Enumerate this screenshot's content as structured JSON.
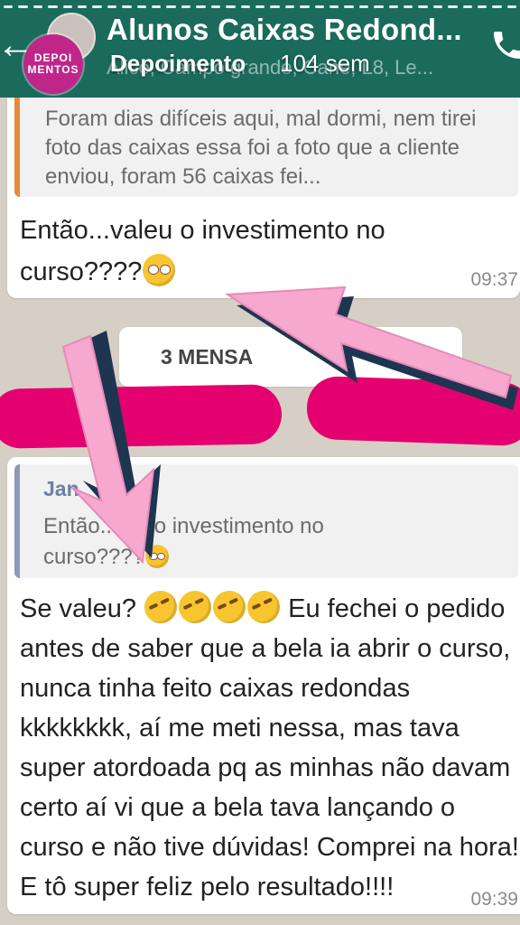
{
  "header": {
    "title": "Alunos Caixas Redond...",
    "subtitle": "Alice, Campo grande, Cane, L8, Le...",
    "back_glyph": "←"
  },
  "story": {
    "badge_text": "DEPOI MENTOS",
    "name": "Depoimento",
    "time_ago": "104 sem"
  },
  "messages": [
    {
      "quoted_text": "Foram dias difíceis aqui, mal dormi, nem tirei foto das caixas essa foi a foto que a cliente enviou, foram 56 caixas fei...",
      "text": "Então...valeu o investimento no curso????",
      "emoji": "face-with-rolling-eyes",
      "time": "09:37"
    },
    {
      "quoted_author": "Jan",
      "quoted_text_a": "Então...",
      "quoted_text_b": "eu o investimento no",
      "quoted_text_c": "curso????",
      "text_start": "Se valeu?",
      "text_body": "Eu fechei o pedido antes de saber que a bela ia abrir o curso, nunca tinha feito caixas redondas kkkkkkkk, aí me meti nessa, mas tava super atordoada pq as minhas não davam certo aí vi que a bela tava lançando o curso e não tive dúvidas! Comprei na hora! E tô super feliz pelo resultado!!!!",
      "emoji": "rolling-on-the-floor-laughing",
      "time": "09:39"
    }
  ],
  "unread_divider": "3 MENSA",
  "colors": {
    "header_bg": "#1b6b5d",
    "redaction": "#e5006f",
    "arrow_fill": "#f7a8cf",
    "arrow_outline": "#1e3550"
  }
}
